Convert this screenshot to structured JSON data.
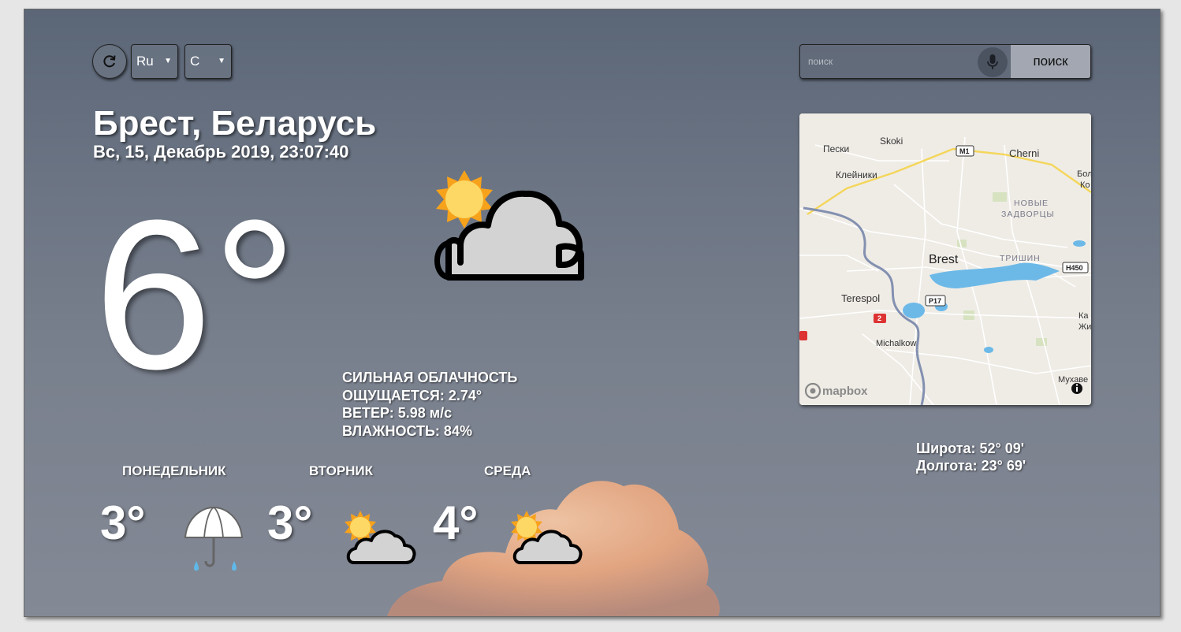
{
  "controls": {
    "language": "Ru",
    "unit": "C",
    "search_placeholder": "поиск",
    "search_button": "поиск"
  },
  "location": {
    "city": "Брест, Беларусь",
    "datetime": "Вс, 15, Декабрь 2019, 23:07:40"
  },
  "current": {
    "temperature": "6°",
    "icon": "sun-behind-cloud-icon",
    "condition": "СИЛЬНАЯ ОБЛАЧНОСТЬ",
    "feels_like": "ОЩУЩАЕТСЯ: 2.74°",
    "wind": "ВЕТЕР: 5.98 м/с",
    "humidity": "ВЛАЖНОСТЬ: 84%"
  },
  "map": {
    "labels": {
      "peski": "Пески",
      "skoki": "Skoki",
      "m1": "M1",
      "cherni": "Cherni",
      "kleiniki": "Клейники",
      "novye": "НОВЫЕ",
      "zadvortsy": "ЗАДВОРЦЫ",
      "brest": "Brest",
      "trishin": "ТРИШИН",
      "h450": "H450",
      "terespol": "Terespol",
      "p17": "P17",
      "route2": "2",
      "michalkow": "Michalkow",
      "mukhavets": "Мухаве",
      "bol": "Бол",
      "ko": "Ко",
      "ka": "Ка",
      "zhir": "Жир",
      "attribution": "mapbox"
    }
  },
  "coordinates": {
    "latitude": "Широта: 52° 09'",
    "longitude": "Долгота: 23° 69'"
  },
  "forecast": [
    {
      "day": "ПОНЕДЕЛЬНИК",
      "temp": "3°",
      "icon": "umbrella-rain-icon"
    },
    {
      "day": "ВТОРНИК",
      "temp": "3°",
      "icon": "sun-behind-cloud-icon"
    },
    {
      "day": "СРЕДА",
      "temp": "4°",
      "icon": "sun-behind-cloud-icon"
    }
  ],
  "colors": {
    "background_top": "#5b6677",
    "background_bottom": "#838995",
    "sun": "#f7a21b",
    "cloud": "#d3d3d3",
    "search_button": "#a2a7b1"
  }
}
